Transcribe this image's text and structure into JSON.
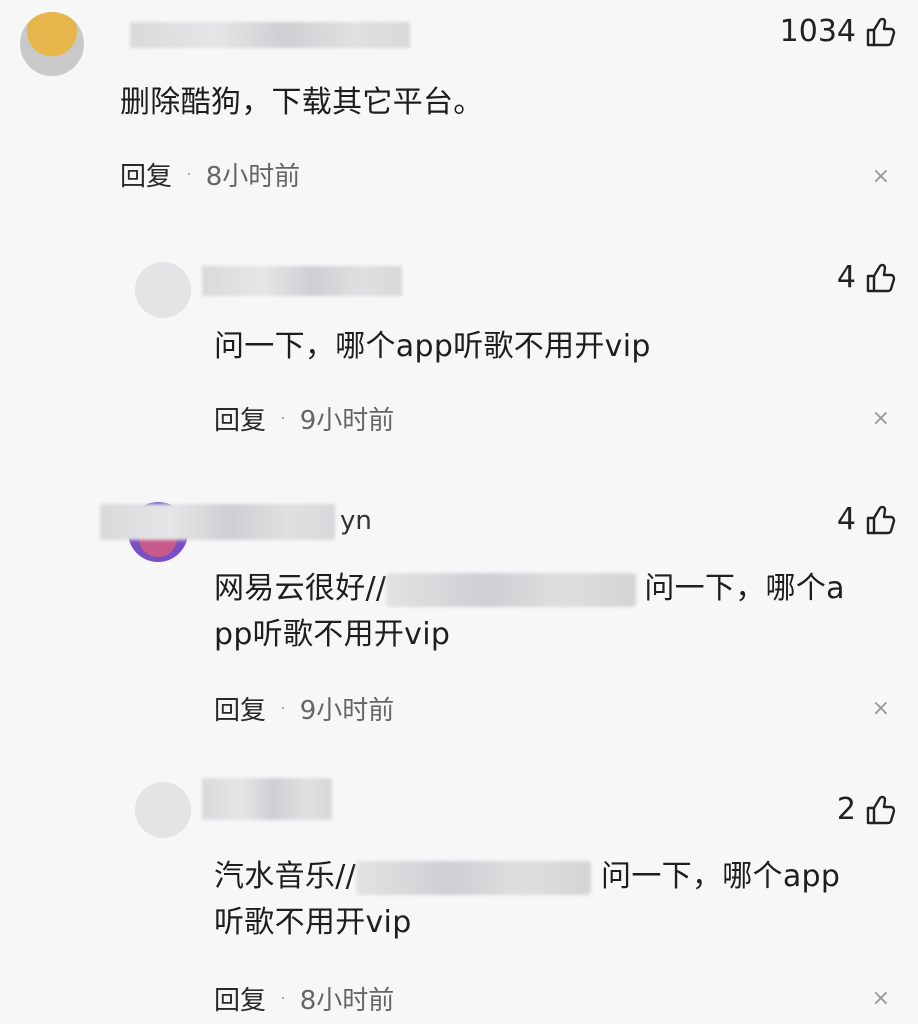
{
  "comments": [
    {
      "likes": "1034",
      "content": "删除酷狗，下载其它平台。",
      "reply_label": "回复",
      "time": "8小时前"
    },
    {
      "likes": "4",
      "content": "问一下，哪个app听歌不用开vip",
      "reply_label": "回复",
      "time": "9小时前"
    },
    {
      "username_tail": "yn",
      "likes": "4",
      "content_prefix": "网易云很好//",
      "content_suffix": "问一下，哪个a",
      "content_line2": "pp听歌不用开vip",
      "reply_label": "回复",
      "time": "9小时前"
    },
    {
      "likes": "2",
      "content_prefix": "汽水音乐//",
      "content_suffix": "问一下，哪个app",
      "content_line2": "听歌不用开vip",
      "reply_label": "回复",
      "time": "8小时前"
    }
  ],
  "icons": {
    "like": "thumbs-up-icon",
    "close": "close-icon"
  },
  "close_glyph": "×"
}
